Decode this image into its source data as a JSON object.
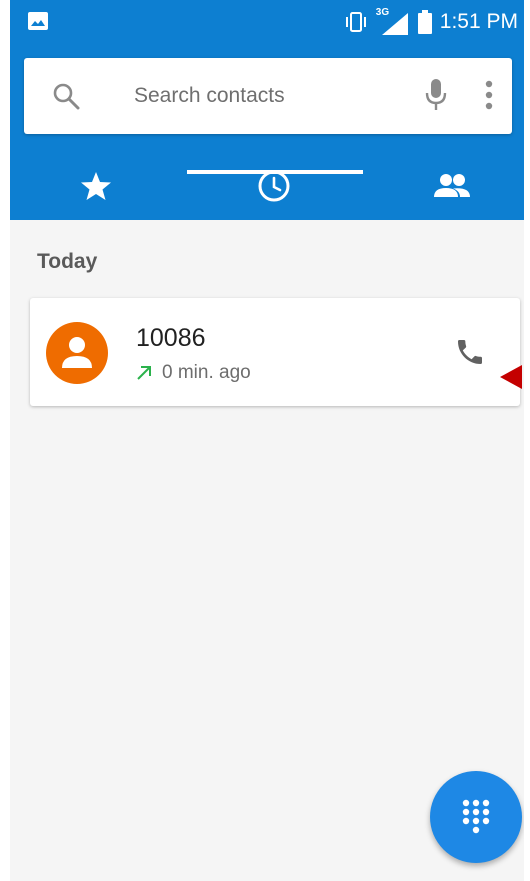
{
  "status_bar": {
    "time": "1:51 PM",
    "network": "3G",
    "icons": [
      "image-icon",
      "vibrate-icon",
      "signal-icon",
      "battery-icon"
    ]
  },
  "search": {
    "placeholder": "Search contacts",
    "icons": [
      "search-icon",
      "mic-icon",
      "more-vert-icon"
    ]
  },
  "tabs": [
    {
      "name": "favorites",
      "icon": "star-icon",
      "selected": false
    },
    {
      "name": "recents",
      "icon": "clock-icon",
      "selected": true
    },
    {
      "name": "contacts",
      "icon": "people-icon",
      "selected": false
    }
  ],
  "recents": {
    "section_title": "Today",
    "calls": [
      {
        "number": "10086",
        "time": "0 min. ago",
        "type": "outgoing",
        "avatar": "person-icon"
      }
    ]
  },
  "fab": {
    "icon": "dialpad-icon"
  },
  "colors": {
    "primary": "#0d7fd1",
    "avatar": "#ef6c00",
    "outgoing_arrow": "#2bb24c",
    "fab": "#1e88e5",
    "annotation_arrow": "#c40000"
  }
}
